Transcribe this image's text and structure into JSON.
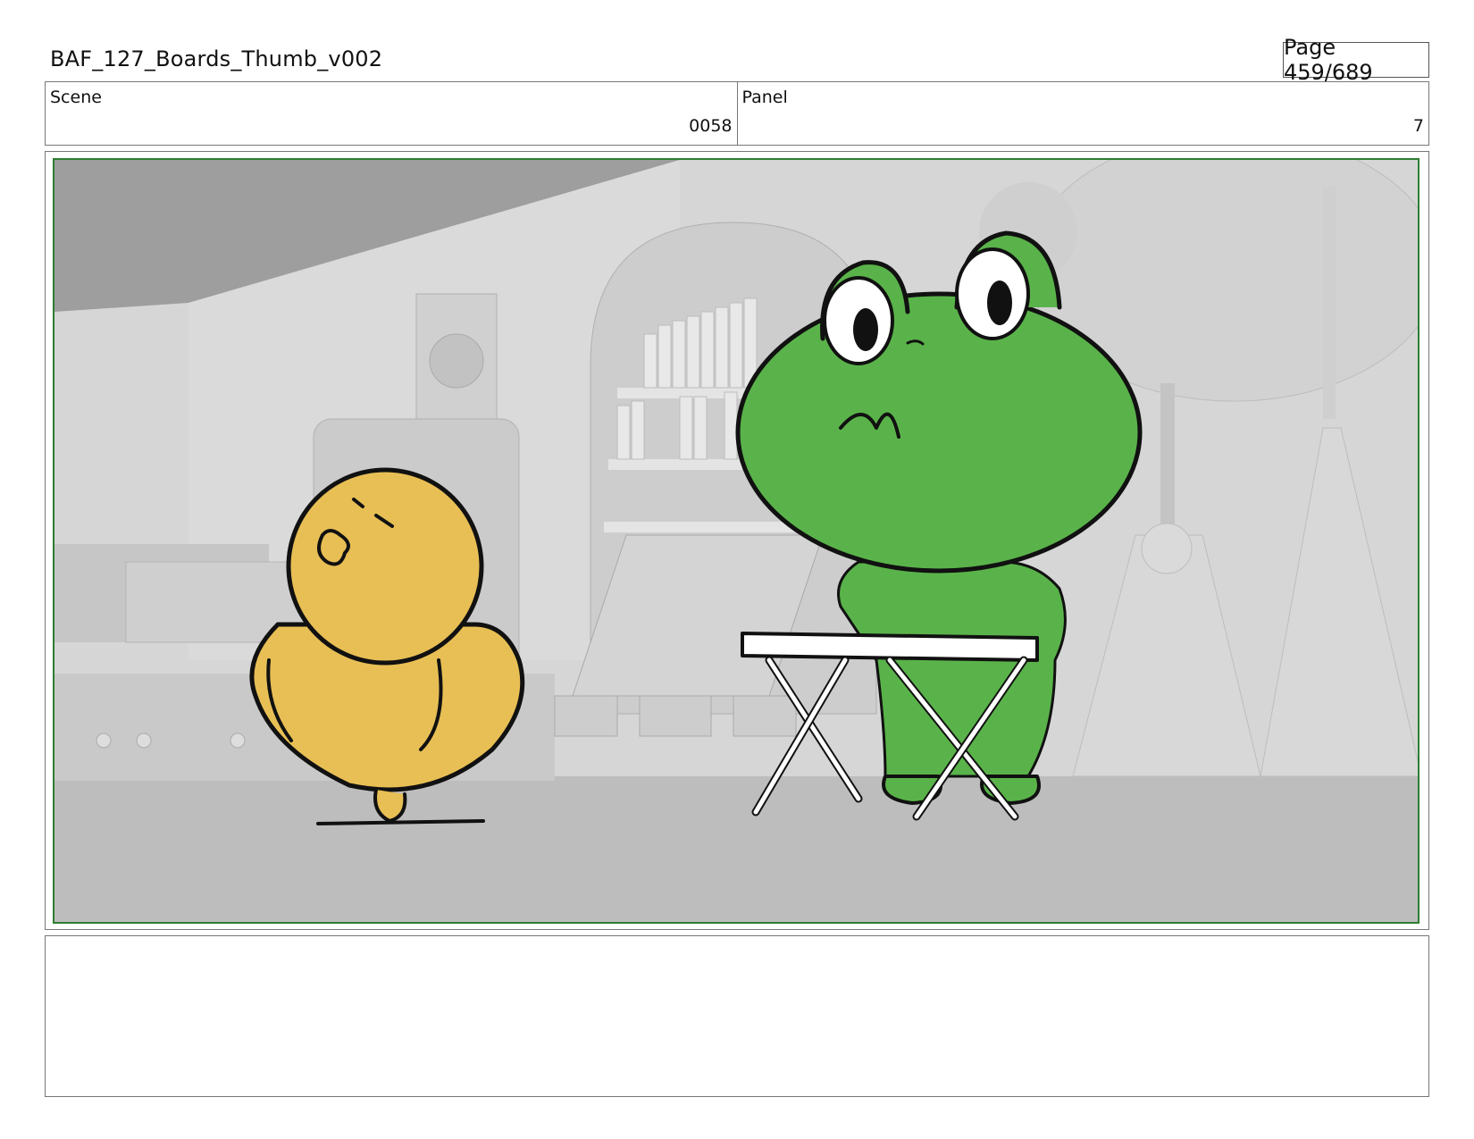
{
  "header": {
    "document_title": "BAF_127_Boards_Thumb_v002",
    "page_label": "Page 459/689"
  },
  "info": {
    "scene_label": "Scene",
    "scene_value": "0058",
    "panel_label": "Panel",
    "panel_value": "7"
  },
  "frame": {
    "border_color": "#2e7d32",
    "colors": {
      "frog_green": "#5ab34a",
      "chick_yellow": "#e8bf55",
      "table_white": "#ffffff",
      "background_gray": "#d0d0d0"
    },
    "icons": [
      "chick-character-icon",
      "frog-character-icon",
      "folding-table-icon",
      "bookshelf-icon",
      "fan-icon",
      "globe-lamp-icon"
    ]
  },
  "notes": {
    "text": ""
  }
}
